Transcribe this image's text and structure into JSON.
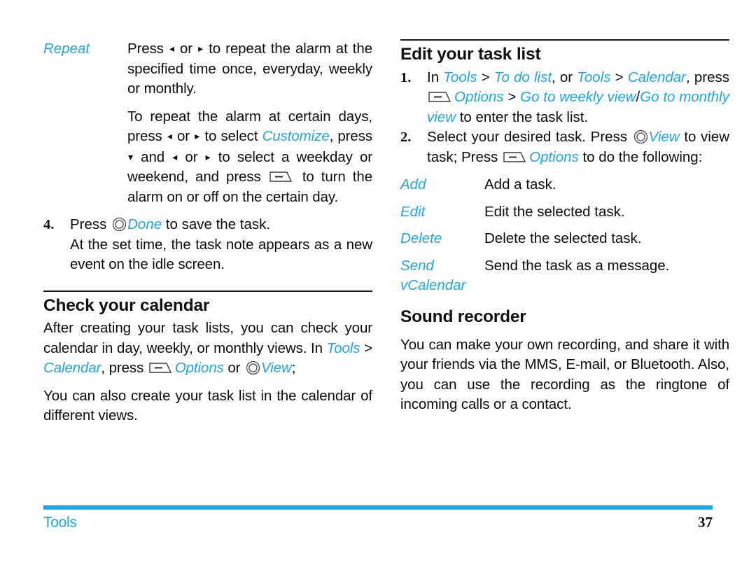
{
  "document": {
    "footer": {
      "section_label": "Tools",
      "page_number": "37"
    },
    "accent_color": "#1BA7EC",
    "text_color": "#0d0d0d"
  },
  "left_column": {
    "repeat_entry": {
      "term": "Repeat",
      "paragraph_1_part_1": "Press ",
      "paragraph_1_part_2": " or ",
      "paragraph_1_part_3": " to repeat the alarm at the specified time once, everyday, weekly or monthly.",
      "paragraph_2_part_1": "To repeat the alarm at certain days, press ",
      "paragraph_2_part_2": " or ",
      "paragraph_2_part_3": " to select ",
      "paragraph_2_term": "Customize",
      "paragraph_2_part_4": ", press ",
      "paragraph_2_part_5": " and ",
      "paragraph_2_part_6": " or ",
      "paragraph_2_part_7": " to select a weekday or weekend, and press ",
      "paragraph_2_part_8": " to turn the alarm on or off on the certain day."
    },
    "step_4": {
      "number": "4.",
      "text_part_1": "Press ",
      "term": "Done",
      "text_part_2": " to save the task.",
      "text_part_3": "At the set time, the task note appears as a new event on the idle screen."
    },
    "check_calendar": {
      "heading": "Check your calendar",
      "para_1_part_1": "After creating your task lists, you can check your calendar in day, weekly, or monthly views. In ",
      "para_1_term_1": "Tools",
      "para_1_sep_1": " > ",
      "para_1_term_2": "Calendar",
      "para_1_part_2": ", press ",
      "para_1_term_3": "Options",
      "para_1_part_3": " or ",
      "para_1_term_4": "View",
      "para_1_part_4": ";",
      "para_2": "You can also create your task list in the calendar of different views."
    }
  },
  "right_column": {
    "edit_task_list": {
      "heading": "Edit your task list",
      "step_1": {
        "number": "1.",
        "part_1": "In ",
        "term_1": "Tools",
        "sep_1": " > ",
        "term_2": "To do list",
        "part_2": ", or ",
        "term_3": "Tools",
        "sep_2": " > ",
        "term_4": "Calendar",
        "part_3": ", press ",
        "term_5": "Options",
        "sep_3": " > ",
        "term_6": "Go to weekly view",
        "sep_4": "/",
        "term_7": "Go to monthly view",
        "part_4": " to enter the task list."
      },
      "step_2": {
        "number": "2.",
        "part_1": "Select your desired task. Press ",
        "term_1": "View",
        "part_2": " to view task; Press ",
        "term_2": "Options",
        "part_3": " to do the following:"
      },
      "options": [
        {
          "term": "Add",
          "description": "Add a task."
        },
        {
          "term": "Edit",
          "description": "Edit the selected task."
        },
        {
          "term": "Delete",
          "description": "Delete the selected task."
        },
        {
          "term": "Send vCalendar",
          "description": "Send the task as a message."
        }
      ]
    },
    "sound_recorder": {
      "heading": "Sound recorder",
      "paragraph": "You can make your own recording, and share it with your friends via the MMS, E-mail, or Bluetooth. Also, you can use the recording as the ringtone of incoming calls or a contact."
    }
  },
  "icons": {
    "softkey": "left-softkey-icon",
    "okkey": "ok-center-key-icon",
    "arrow_left": "◂",
    "arrow_right": "▸",
    "arrow_down": "▾"
  }
}
